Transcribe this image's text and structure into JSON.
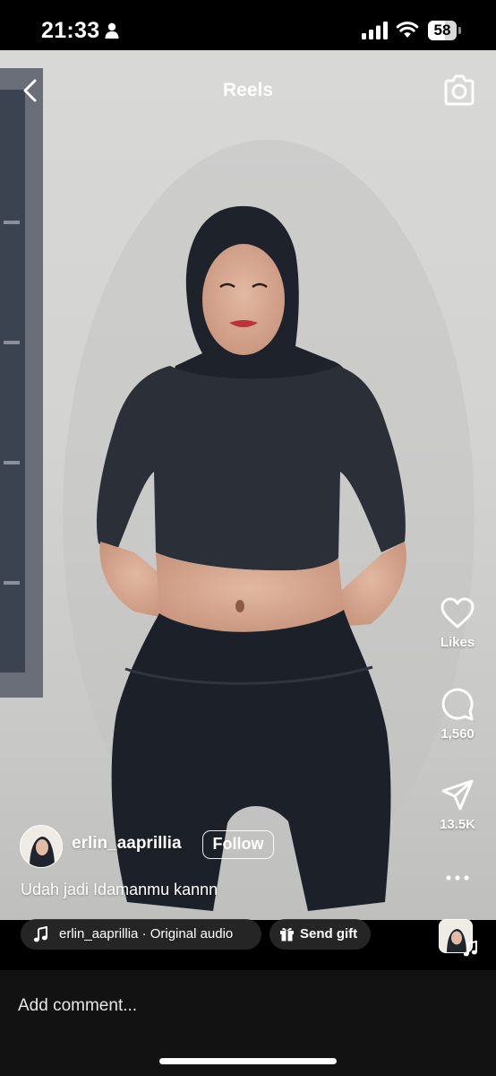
{
  "status_bar": {
    "time": "21:33",
    "battery_level": "58",
    "battery_fraction": 0.58
  },
  "top_bar": {
    "title": "Reels",
    "back_icon": "chevron-left-icon",
    "camera_icon": "camera-icon"
  },
  "actions": {
    "like": {
      "icon": "heart-icon",
      "label": "Likes"
    },
    "comment": {
      "icon": "comment-bubble-icon",
      "label": "1,560"
    },
    "share": {
      "icon": "paper-plane-icon",
      "label": "13.5K"
    },
    "more": {
      "icon": "more-icon"
    }
  },
  "post": {
    "username": "erlin_aaprillia",
    "follow_label": "Follow",
    "caption": "Udah jadi Idamanmu kannn"
  },
  "audio": {
    "icon": "music-note-icon",
    "label": "erlin_aaprillia · Original audio"
  },
  "gift": {
    "icon": "gift-icon",
    "label": "Send gift"
  },
  "comment": {
    "placeholder": "Add comment..."
  },
  "colors": {
    "background": "#000000",
    "comment_bar": "#121212",
    "pill": "#282828",
    "text": "#ffffff"
  }
}
